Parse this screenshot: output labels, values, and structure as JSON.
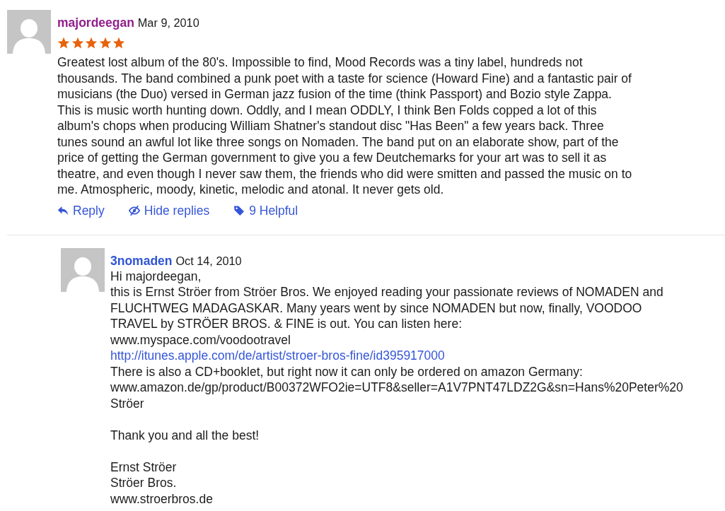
{
  "review": {
    "author": "majordeegan",
    "date": "Mar 9, 2010",
    "stars": 5,
    "text": "Greatest lost album of the 80's. Impossible to find, Mood Records was a tiny label, hundreds not thousands. The band combined a punk poet with a taste for science (Howard Fine) and a fantastic pair of musicians (the Duo) versed in German jazz fusion of the time (think Passport) and Bozio style Zappa. This is music worth hunting down. Oddly, and I mean ODDLY, I think Ben Folds copped a lot of this album's chops when producing William Shatner's standout disc \"Has Been\" a few years back. Three tunes sound an awful lot like three songs on Nomaden. The band put on an elaborate show, part of the price of getting the German government to give you a few Deutchemarks for your art was to sell it as theatre, and even though I never saw them, the friends who did were smitten and passed the music on to me. Atmospheric, moody, kinetic, melodic and atonal. It never gets old.",
    "actions": [
      {
        "kind": "reply",
        "label": "Reply"
      },
      {
        "kind": "hide",
        "label": "Hide replies"
      },
      {
        "kind": "helpful",
        "label": "9 Helpful"
      }
    ]
  },
  "replies": [
    {
      "author": "3nomaden",
      "date": "Oct 14, 2010",
      "paragraphs": [
        [
          {
            "kind": "text",
            "text": "Hi majordeegan,"
          },
          {
            "kind": "text",
            "text": "this is Ernst Ströer from Ströer Bros. We enjoyed reading your passionate reviews of NOMADEN and FLUCHTWEG MADAGASKAR. Many years went by since NOMADEN but now, finally, VOODOO TRAVEL by STRÖER BROS. & FINE is out. You can listen here:"
          },
          {
            "kind": "text",
            "text": "www.myspace.com/voodootravel"
          },
          {
            "kind": "link",
            "text": "http://itunes.apple.com/de/artist/stroer-bros-fine/id395917000"
          },
          {
            "kind": "text",
            "text": "There is also a CD+booklet, but right now it can only be ordered on amazon Germany:"
          },
          {
            "kind": "text",
            "text": "www.amazon.de/gp/product/B00372WFO2ie=UTF8&seller=A1V7PNT47LDZ2G&sn=Hans%20Peter%20"
          },
          {
            "kind": "text",
            "text": "Ströer"
          }
        ],
        [
          {
            "kind": "text",
            "text": "Thank you and all the best!"
          }
        ],
        [
          {
            "kind": "text",
            "text": "Ernst Ströer"
          },
          {
            "kind": "text",
            "text": "Ströer Bros."
          },
          {
            "kind": "text",
            "text": "www.stroerbros.de"
          }
        ]
      ]
    }
  ]
}
